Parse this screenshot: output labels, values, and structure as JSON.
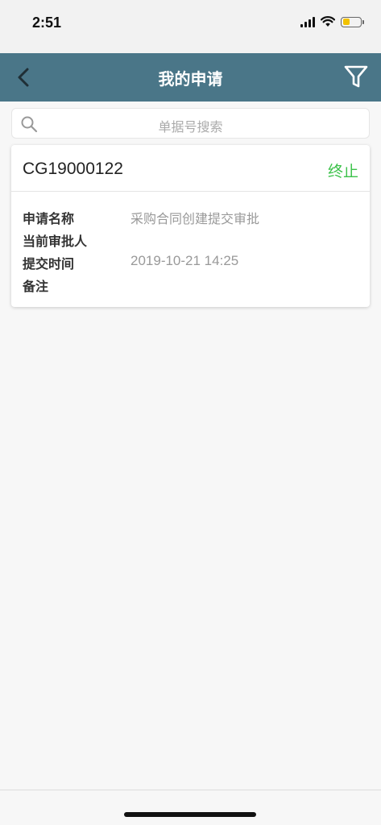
{
  "status_bar": {
    "time": "2:51",
    "battery_level": 0.35,
    "battery_color": "#f2c200"
  },
  "nav": {
    "title": "我的申请",
    "back_icon": "chevron-left-icon",
    "filter_icon": "filter-icon",
    "background": "#4a7688"
  },
  "search": {
    "placeholder": "单据号搜索",
    "icon": "search-icon"
  },
  "requests": [
    {
      "number": "CG19000122",
      "status": "终止",
      "status_color": "#3cc24a",
      "fields": [
        {
          "label": "申请名称",
          "value": "采购合同创建提交审批"
        },
        {
          "label": "当前审批人",
          "value": ""
        },
        {
          "label": "提交时间",
          "value": "2019-10-21 14:25"
        },
        {
          "label": "备注",
          "value": ""
        }
      ]
    }
  ]
}
